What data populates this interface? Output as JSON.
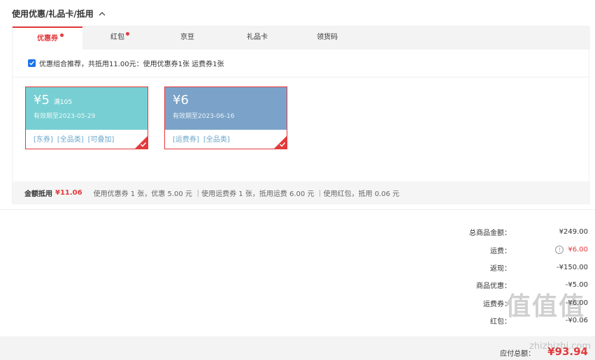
{
  "section": {
    "title": "使用优惠/礼品卡/抵用"
  },
  "tabs": [
    {
      "label": "优惠券",
      "active": true,
      "dot": true
    },
    {
      "label": "红包",
      "active": false,
      "dot": true
    },
    {
      "label": "京豆",
      "active": false,
      "dot": false
    },
    {
      "label": "礼品卡",
      "active": false,
      "dot": false
    },
    {
      "label": "领货码",
      "active": false,
      "dot": false
    }
  ],
  "combo": {
    "checked": true,
    "text": "优惠组合推荐，共抵用11.00元：使用优惠券1张 运费券1张"
  },
  "coupons": [
    {
      "amount": "¥5",
      "condition": "满105",
      "expiry": "有效期至2023-05-29",
      "tags": [
        "[东券]",
        "[全品类]",
        "[可叠加]"
      ],
      "color": "#77cfd3",
      "selected": true
    },
    {
      "amount": "¥6",
      "condition": "",
      "expiry": "有效期至2023-06-16",
      "tags": [
        "[运费券]",
        "[全品类]"
      ],
      "color": "#7ba3c9",
      "selected": true
    }
  ],
  "summary": {
    "label": "金额抵用",
    "amount": "¥11.06",
    "detail": "使用优惠券 1 张，优惠 5.00 元 ｜使用运费券 1 张，抵用运费 6.00 元 ｜使用红包，抵用 0.06 元"
  },
  "totals": [
    {
      "label": "总商品金额：",
      "value": "¥249.00",
      "highlight": false,
      "info": false
    },
    {
      "label": "运费：",
      "value": "¥6.00",
      "highlight": true,
      "info": true
    },
    {
      "label": "返现：",
      "value": "-¥150.00",
      "highlight": false,
      "info": false
    },
    {
      "label": "商品优惠：",
      "value": "-¥5.00",
      "highlight": false,
      "info": false
    },
    {
      "label": "运费券：",
      "value": "-¥6.00",
      "highlight": false,
      "info": false
    },
    {
      "label": "红包：",
      "value": "-¥0.06",
      "highlight": false,
      "info": false
    }
  ],
  "grand": {
    "label": "应付总额：",
    "value": "¥93.94"
  },
  "watermark": {
    "logo": "值值值",
    "site": "zhizhizhi.com"
  },
  "colors": {
    "accent": "#e4393c",
    "teal": "#77cfd3",
    "blue": "#7ba3c9"
  }
}
